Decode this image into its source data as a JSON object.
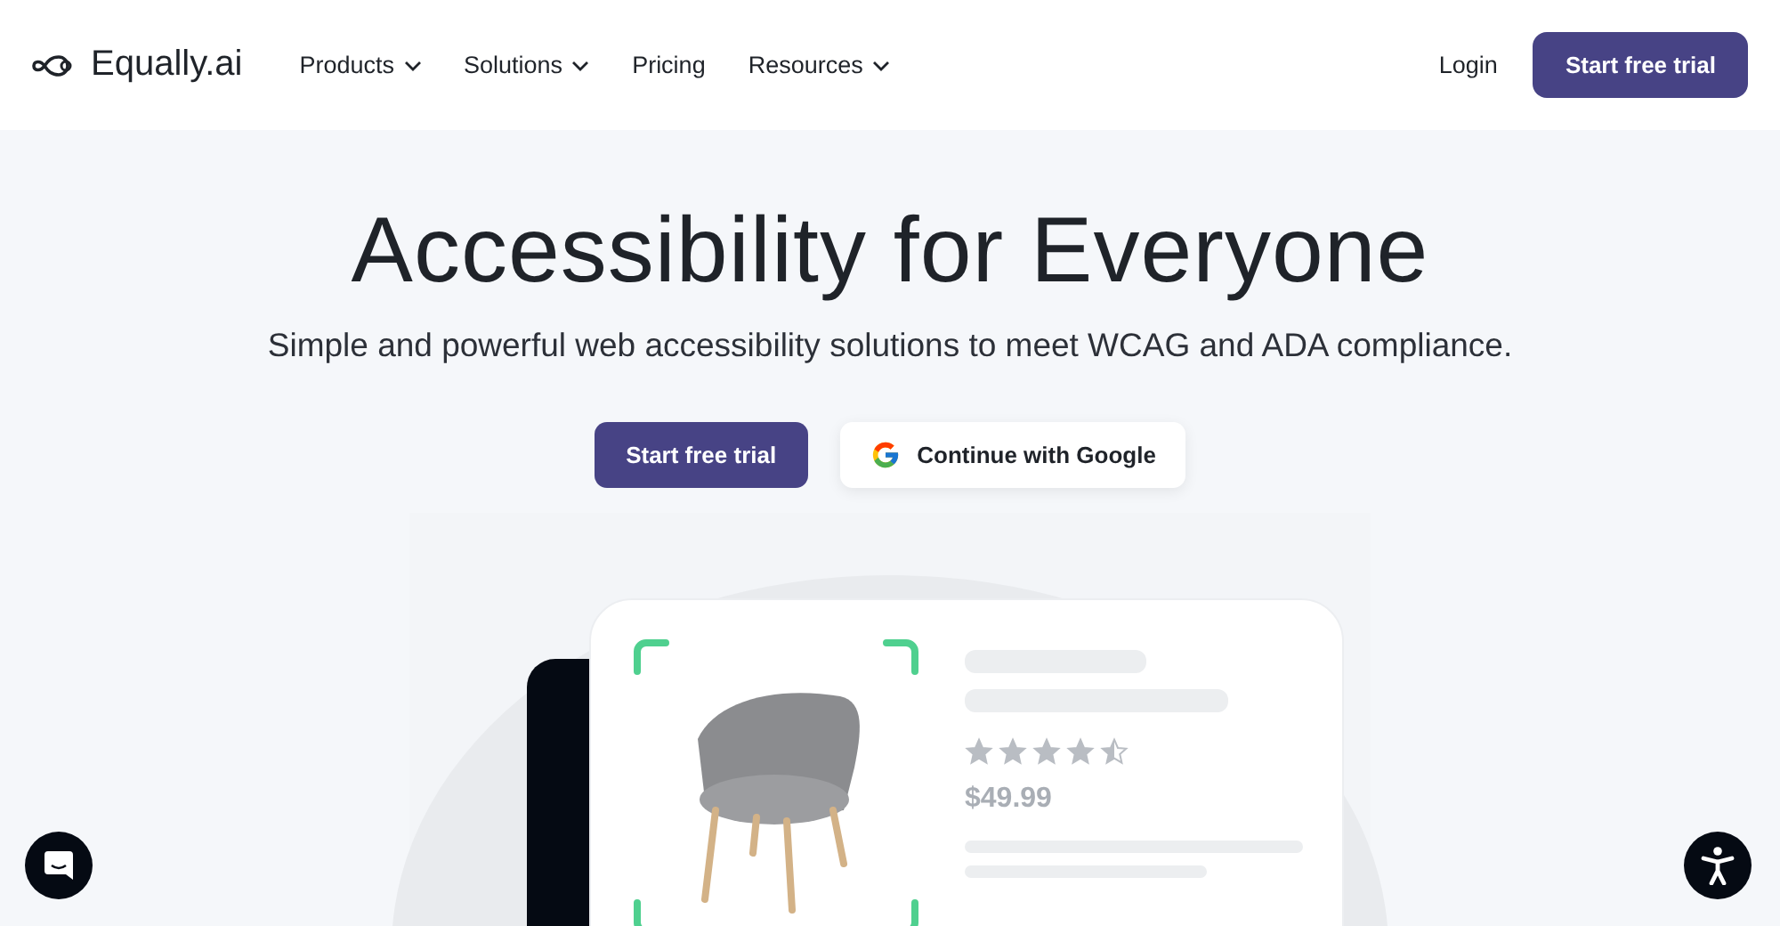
{
  "header": {
    "logo": "Equally.ai",
    "nav": [
      {
        "label": "Products",
        "dropdown": true
      },
      {
        "label": "Solutions",
        "dropdown": true
      },
      {
        "label": "Pricing",
        "dropdown": false
      },
      {
        "label": "Resources",
        "dropdown": true
      }
    ],
    "login": "Login",
    "cta": "Start free trial"
  },
  "hero": {
    "title": "Accessibility for Everyone",
    "subtitle": "Simple and powerful web accessibility solutions to meet WCAG and ADA compliance.",
    "primary_button": "Start free trial",
    "google_button": "Continue with Google"
  },
  "product_card": {
    "stars": 4.5,
    "price": "$49.99"
  }
}
